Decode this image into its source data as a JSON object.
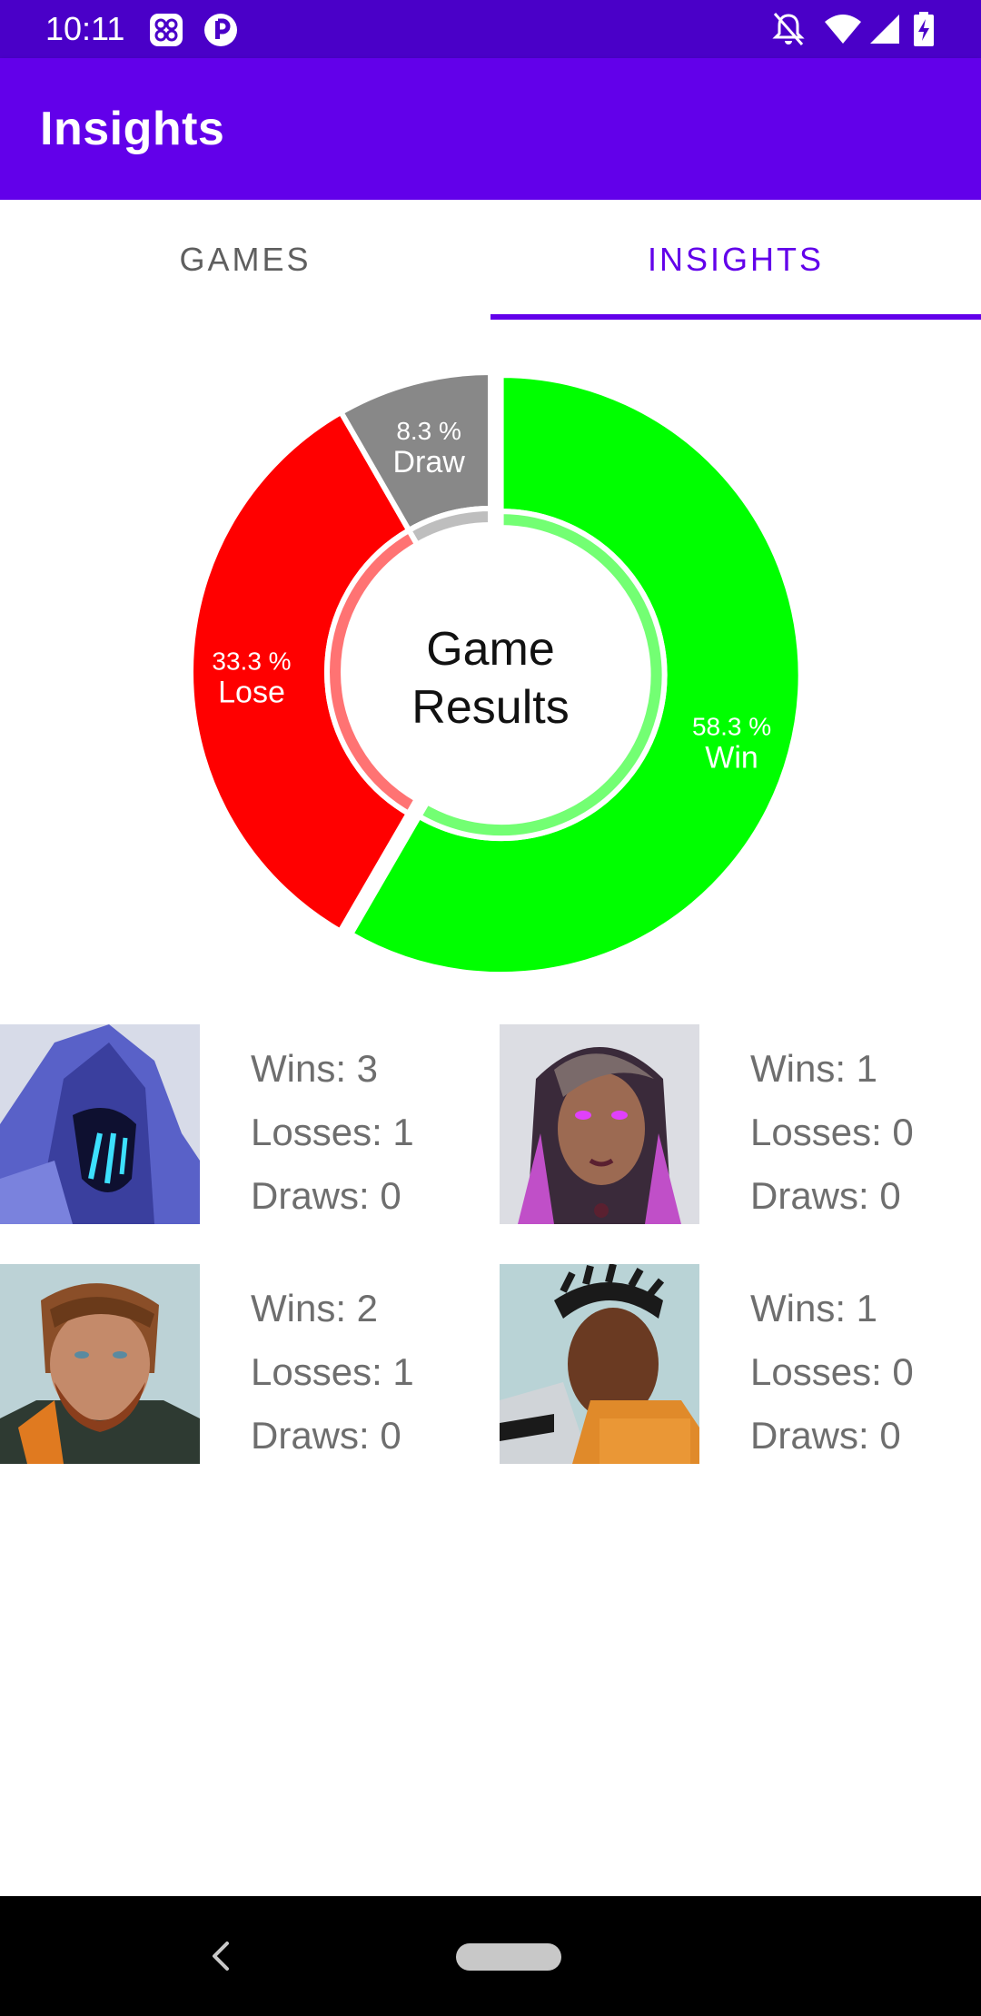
{
  "status_bar": {
    "time": "10:11",
    "icons": [
      "grid-app-icon",
      "p-app-icon",
      "notifications-off-icon",
      "wifi-icon",
      "cell-signal-icon",
      "battery-charging-icon"
    ],
    "background": "#4a00c8"
  },
  "app_bar": {
    "title": "Insights",
    "background": "#6200ea"
  },
  "tabs": [
    {
      "label": "GAMES",
      "selected": false
    },
    {
      "label": "INSIGHTS",
      "selected": true
    }
  ],
  "chart_data": {
    "type": "pie",
    "variant": "donut",
    "center_title": [
      "Game",
      "Results"
    ],
    "slices": [
      {
        "label": "Win",
        "percent_label": "58.3 %",
        "value": 58.3,
        "color": "#00ff00"
      },
      {
        "label": "Lose",
        "percent_label": "33.3 %",
        "value": 33.3,
        "color": "#ff0000"
      },
      {
        "label": "Draw",
        "percent_label": "8.3 %",
        "value": 8.3,
        "color": "#888888"
      }
    ],
    "selected_slice": "Win"
  },
  "agents": [
    {
      "portrait": "omen-portrait",
      "wins": "Wins: 3",
      "losses": "Losses: 1",
      "draws": "Draws: 0"
    },
    {
      "portrait": "reyna-portrait",
      "wins": "Wins: 1",
      "losses": "Losses: 0",
      "draws": "Draws: 0"
    },
    {
      "portrait": "sova-portrait",
      "wins": "Wins: 2",
      "losses": "Losses: 1",
      "draws": "Draws: 0"
    },
    {
      "portrait": "phoenix-portrait",
      "wins": "Wins: 1",
      "losses": "Losses: 0",
      "draws": "Draws: 0"
    }
  ],
  "nav_bar": {
    "icons": [
      "back-icon",
      "home-pill-icon"
    ]
  }
}
